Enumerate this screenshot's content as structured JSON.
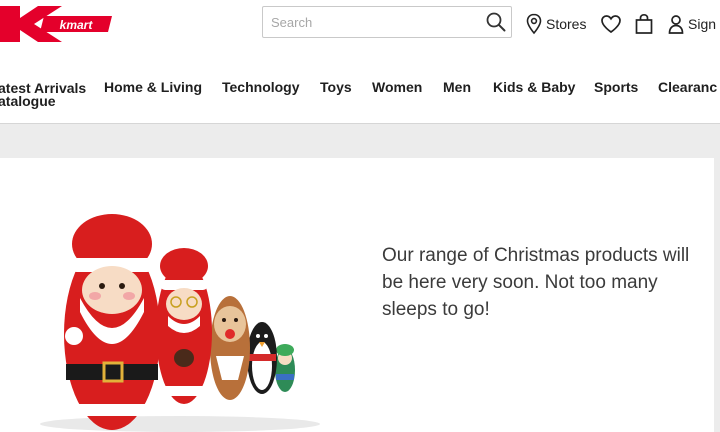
{
  "brand": {
    "logo_text": "kmart",
    "logo_color": "#e4002b"
  },
  "search": {
    "placeholder": "Search"
  },
  "utilities": {
    "stores_label": "Stores",
    "signin_label": "Sign"
  },
  "nav": {
    "items": [
      {
        "line1": "atest Arrivals",
        "line2": "atalogue"
      },
      {
        "line1": "Home & Living"
      },
      {
        "line1": "Technology"
      },
      {
        "line1": "Toys"
      },
      {
        "line1": "Women"
      },
      {
        "line1": "Men"
      },
      {
        "line1": "Kids & Baby"
      },
      {
        "line1": "Sports"
      },
      {
        "line1": "Clearanc"
      }
    ]
  },
  "hero": {
    "message": "Our range of Christmas products will be here very soon. Not too many sleeps to go!",
    "image_desc_icons": [
      "santa-doll-icon",
      "mrs-claus-doll-icon",
      "reindeer-doll-icon",
      "penguin-doll-icon",
      "elf-doll-icon"
    ]
  }
}
